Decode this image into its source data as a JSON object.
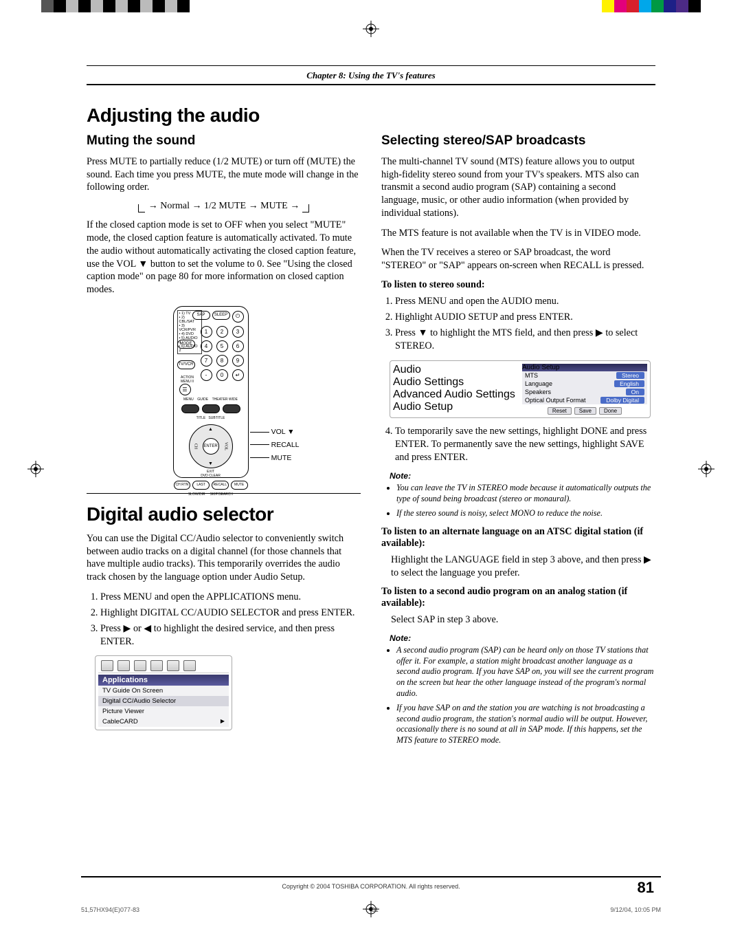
{
  "chapter": "Chapter 8: Using the TV's features",
  "h1": "Adjusting the audio",
  "left": {
    "muting_h2": "Muting the sound",
    "muting_p1": "Press MUTE to partially reduce (1/2 MUTE) or turn off (MUTE) the sound. Each time you press MUTE, the mute mode will change in the following order.",
    "mute_chain": "Normal → 1/2 MUTE → MUTE →",
    "muting_p2": "If the closed caption mode is set to OFF when you select \"MUTE\" mode, the closed caption feature is automatically activated. To mute the audio without automatically activating the closed caption feature, use the VOL ▼ button to set the volume to 0. See \"Using the closed caption mode\" on page 80 for more information on closed caption modes.",
    "remote_labels": {
      "vol": "VOL ▼",
      "recall": "RECALL",
      "mute": "MUTE"
    },
    "remote_inputs": [
      "• 1) TV",
      "• 2) CBL/SAT",
      "• 3) VCR/PVR",
      "• 4) DVD",
      "• 5) AUDIO 1",
      "• 6) AUDIO 2"
    ],
    "remote_pills": {
      "sap": "SAP",
      "sleep": "SLEEP",
      "mode": "MODE",
      "tvvcr": "TV/VCR",
      "action": "ACTION MENU II",
      "enter": "ENTER"
    },
    "das_h1": "Digital audio selector",
    "das_p1": "You can use the Digital CC/Audio selector to conveniently switch between audio tracks on a digital channel (for those channels that have multiple audio tracks). This temporarily overrides the audio track chosen by the language option under Audio Setup.",
    "das_steps": [
      "Press MENU and open the APPLICATIONS menu.",
      "Highlight DIGITAL CC/AUDIO SELECTOR and press ENTER.",
      "Press ▶ or ◀ to highlight the desired service, and then press ENTER."
    ],
    "apps_menu": {
      "title": "Applications",
      "items": [
        "TV Guide On Screen",
        "Digital CC/Audio Selector",
        "Picture Viewer",
        "CableCARD"
      ]
    }
  },
  "right": {
    "sap_h2": "Selecting stereo/SAP broadcasts",
    "sap_p1": "The multi-channel TV sound (MTS) feature allows you to output high-fidelity stereo sound from your TV's speakers. MTS also can transmit a second audio program (SAP) containing a second language, music, or other audio information (when provided by individual stations).",
    "sap_p2": "The MTS feature is not available when the TV is in VIDEO mode.",
    "sap_p3": "When the TV receives a stereo or SAP broadcast, the word \"STEREO\" or \"SAP\" appears on-screen when RECALL is pressed.",
    "stereo_head": "To listen to stereo sound:",
    "stereo_steps": [
      "Press MENU and open the AUDIO menu.",
      "Highlight AUDIO SETUP and press ENTER.",
      "Press ▼ to highlight the MTS field, and then press ▶ to select STEREO."
    ],
    "audio_menu": {
      "left_title": "Audio",
      "left_items": [
        "Audio Settings",
        "Advanced Audio Settings",
        "Audio Setup"
      ],
      "right_title": "Audio Setup",
      "rows": [
        {
          "k": "MTS",
          "v": "Stereo"
        },
        {
          "k": "Language",
          "v": "English"
        },
        {
          "k": "Speakers",
          "v": "On"
        },
        {
          "k": "Optical Output Format",
          "v": "Dolby Digital"
        }
      ],
      "buttons": [
        "Reset",
        "Save",
        "Done"
      ]
    },
    "step4": "To temporarily save the new settings, highlight DONE and press ENTER. To permanently save the new settings, highlight SAVE and press ENTER.",
    "note_label": "Note:",
    "notes1": [
      "You can leave the TV in STEREO mode because it automatically outputs the type of sound being broadcast (stereo or monaural).",
      "If the stereo sound is noisy, select MONO to reduce the noise."
    ],
    "atsc_head": "To listen to an alternate language on an ATSC digital station (if available):",
    "atsc_body": "Highlight the LANGUAGE field in step 3 above, and then press ▶ to select the language you prefer.",
    "analog_head": "To listen to a second audio program on an analog station (if available):",
    "analog_body": "Select SAP in step 3 above.",
    "notes2": [
      "A second audio program (SAP) can be heard only on those TV stations that offer it. For example, a station might broadcast another language as a second audio program. If you have SAP on, you will see the current program on the screen but hear the other language instead of the program's normal audio.",
      "If you have SAP on and the station you are watching is not broadcasting a second audio program, the station's normal audio will be output. However, occasionally there is no sound at all in SAP mode. If this happens, set the MTS feature to STEREO mode."
    ]
  },
  "footer": {
    "copyright": "Copyright © 2004 TOSHIBA CORPORATION. All rights reserved.",
    "page": "81",
    "docid": "51,57HX94(E)077-83",
    "sheet": "81",
    "timestamp": "9/12/04, 10:05 PM"
  },
  "colorbars": {
    "left": [
      "#555",
      "#000",
      "#bbb",
      "#000",
      "#bbb",
      "#000",
      "#bbb",
      "#000",
      "#bbb",
      "#000",
      "#bbb",
      "#000"
    ],
    "right": [
      "#fff",
      "#fff100",
      "#e3007b",
      "#d71f2b",
      "#00a7ea",
      "#009944",
      "#1d2087",
      "#4c2a86",
      "#000"
    ]
  }
}
